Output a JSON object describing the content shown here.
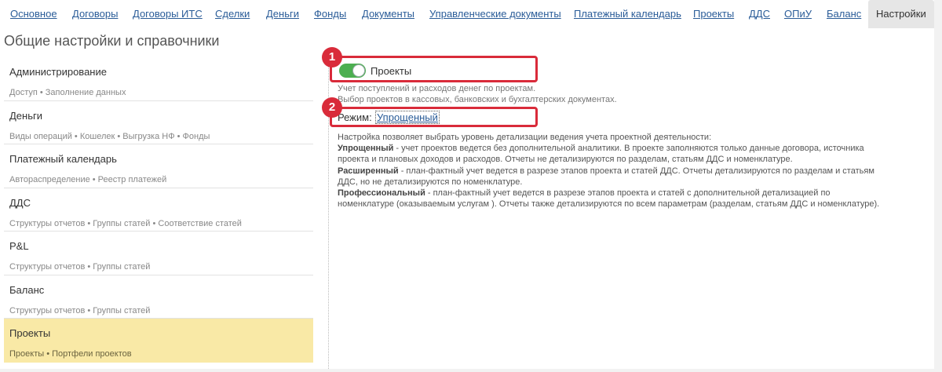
{
  "tabs": [
    {
      "label": "Основное",
      "active": false
    },
    {
      "label": "Договоры",
      "active": false
    },
    {
      "label": "Договоры ИТС",
      "active": false
    },
    {
      "label": "Сделки",
      "active": false
    },
    {
      "label": "Деньги",
      "active": false
    },
    {
      "label": "Фонды",
      "active": false
    },
    {
      "label": "Документы",
      "active": false
    },
    {
      "label": "Управленческие документы",
      "active": false
    },
    {
      "label": "Платежный календарь",
      "active": false
    },
    {
      "label": "Проекты",
      "active": false
    },
    {
      "label": "ДДС",
      "active": false
    },
    {
      "label": "ОПиУ",
      "active": false
    },
    {
      "label": "Баланс",
      "active": false
    },
    {
      "label": "Настройки",
      "active": true
    }
  ],
  "page_title": "Общие настройки и справочники",
  "nav": [
    {
      "title": "Администрирование",
      "sub": "Доступ • Заполнение данных",
      "selected": false
    },
    {
      "title": "Деньги",
      "sub": "Виды операций • Кошелек • Выгрузка НФ • Фонды",
      "selected": false
    },
    {
      "title": "Платежный календарь",
      "sub": "Автораспределение • Реестр платежей",
      "selected": false
    },
    {
      "title": "ДДС",
      "sub": "Структуры отчетов • Группы статей • Соответствие статей",
      "selected": false
    },
    {
      "title": "P&L",
      "sub": "Структуры отчетов • Группы статей",
      "selected": false
    },
    {
      "title": "Баланс",
      "sub": "Структуры отчетов • Группы статей",
      "selected": false
    },
    {
      "title": "Проекты",
      "sub": "Проекты • Портфели проектов",
      "selected": true
    }
  ],
  "settings": {
    "toggle_label": "Проекты",
    "toggle_on": true,
    "toggle_desc_1": "Учет поступлений и расходов денег по проектам.",
    "toggle_desc_2": "Выбор проектов в кассовых, банковских и бухгалтерских документах.",
    "mode_label": "Режим:",
    "mode_value": "Упрощенный",
    "desc_intro": "Настройка позволяет выбрать уровень детализации ведения учета проектной деятельности:",
    "simple_name": "Упрощенный",
    "simple_text_1": " - учет проектов ведется без дополнительной аналитики. В проекте заполняются только данные договора, источника",
    "simple_text_2": "проекта и плановых доходов и расходов. Отчеты не детализируются по разделам, статьям ДДС и номенклатуре.",
    "extended_name": "Расширенный",
    "extended_text_1": " - план-фактный учет ведется в разрезе этапов проекта и статей ДДС. Отчеты детализируются по разделам и статьям",
    "extended_text_2": "ДДС, но не детализируются по номенклатуре.",
    "pro_name": "Профессиональный",
    "pro_text_1": " - план-фактный учет ведется в разрезе этапов проекта и статей с дополнительной детализацией по",
    "pro_text_2": "номенклатуре (оказываемым услугам ). Отчеты также детализируются по всем параметрам (разделам, статьям ДДС и номенклатуре)."
  },
  "callouts": [
    "1",
    "2"
  ],
  "colors": {
    "accent": "#d92b3a",
    "link": "#2a5c98",
    "selected": "#f9e9a6",
    "toggle": "#4caf50"
  }
}
